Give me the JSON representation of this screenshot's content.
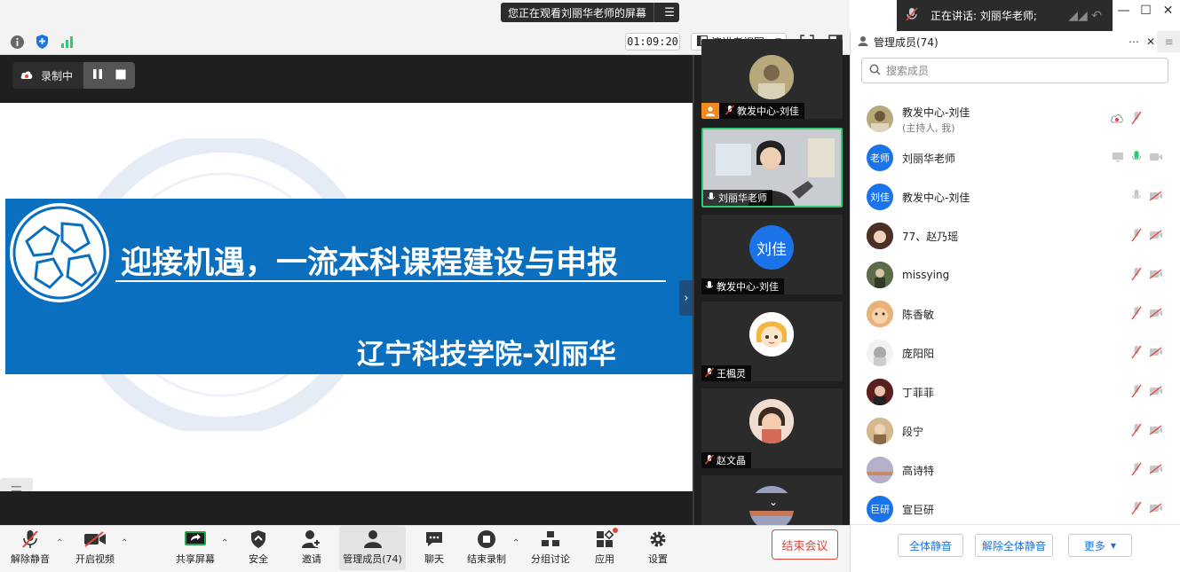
{
  "banner": {
    "text": "您正在观看刘丽华老师的屏幕",
    "menu_icon": "menu-icon"
  },
  "speaking": {
    "text": "正在讲话: 刘丽华老师;"
  },
  "topbar": {
    "timer": "01:09:20",
    "view_label": "演讲者视图"
  },
  "recording": {
    "label": "录制中"
  },
  "slide": {
    "title": "迎接机遇，一流本科课程建设与申报",
    "subtitle": "辽宁科技学院-刘丽华"
  },
  "video_tiles": [
    {
      "name": "教发中心-刘佳"
    },
    {
      "name": "刘丽华老师"
    },
    {
      "name": "教发中心-刘佳",
      "avatar_text": "刘佳"
    },
    {
      "name": "王楓灵"
    },
    {
      "name": "赵文晶"
    }
  ],
  "toolbar": {
    "unmute": "解除静音",
    "start_video": "开启视频",
    "share": "共享屏幕",
    "security": "安全",
    "invite": "邀请",
    "members": "管理成员(74)",
    "chat": "聊天",
    "stop_record": "结束录制",
    "breakout": "分组讨论",
    "apps": "应用",
    "settings": "设置",
    "end_meeting": "结束会议"
  },
  "panel": {
    "title": "管理成员(74)",
    "search_placeholder": "搜索成员",
    "members": [
      {
        "name": "教发中心-刘佳",
        "sub": "(主持人, 我)"
      },
      {
        "name": "刘丽华老师",
        "avatar_text": "老师"
      },
      {
        "name": "教发中心-刘佳",
        "avatar_text": "刘佳"
      },
      {
        "name": "77、赵乃瑶"
      },
      {
        "name": "missying"
      },
      {
        "name": "陈香敏"
      },
      {
        "name": "庞阳阳"
      },
      {
        "name": "丁菲菲"
      },
      {
        "name": "段宁"
      },
      {
        "name": "高诗特"
      },
      {
        "name": "宣巨研",
        "avatar_text": "巨研"
      }
    ],
    "mute_all": "全体静音",
    "unmute_all": "解除全体静音",
    "more": "更多"
  },
  "colors": {
    "accent": "#1a73e8",
    "slide_blue": "#0a6fbf",
    "end_red": "#e0453a",
    "active_green": "#2ecc71"
  }
}
